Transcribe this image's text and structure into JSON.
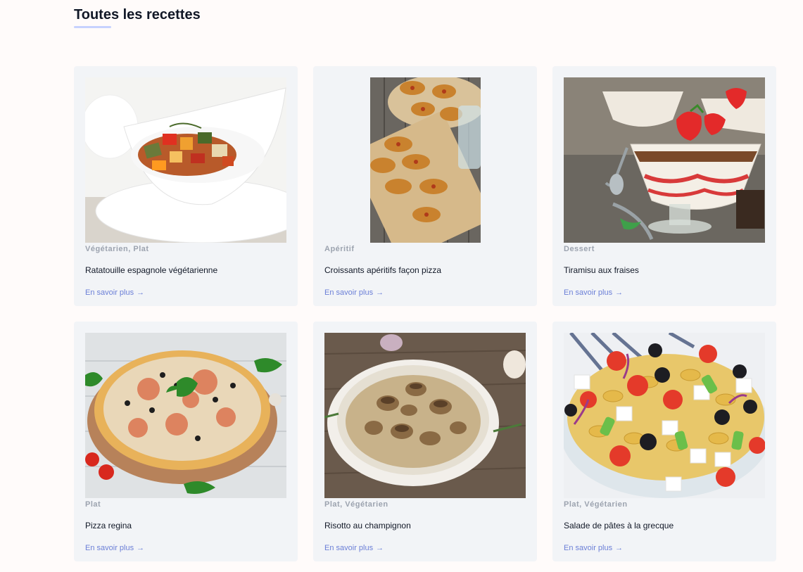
{
  "section": {
    "title": "Toutes les recettes"
  },
  "recipes": [
    {
      "tags": "Végétarien, Plat",
      "name": "Ratatouille espagnole végétarienne",
      "link": "En savoir plus",
      "image": "ratatouille-photo"
    },
    {
      "tags": "Apéritif",
      "name": "Croissants apéritifs façon pizza",
      "link": "En savoir plus",
      "image": "croissants-photo"
    },
    {
      "tags": "Dessert",
      "name": "Tiramisu aux fraises",
      "link": "En savoir plus",
      "image": "tiramisu-photo"
    },
    {
      "tags": "Plat",
      "name": "Pizza regina",
      "link": "En savoir plus",
      "image": "pizza-photo"
    },
    {
      "tags": "Plat, Végétarien",
      "name": "Risotto au champignon",
      "link": "En savoir plus",
      "image": "risotto-photo"
    },
    {
      "tags": "Plat, Végétarien",
      "name": "Salade de pâtes à la grecque",
      "link": "En savoir plus",
      "image": "pasta-salad-photo"
    }
  ],
  "icons": {
    "link_arrow": "arrow-right-icon"
  },
  "colors": {
    "accent": "#6b7fd7",
    "card_bg": "#f2f4f7",
    "underline": "#c7d2fe"
  }
}
